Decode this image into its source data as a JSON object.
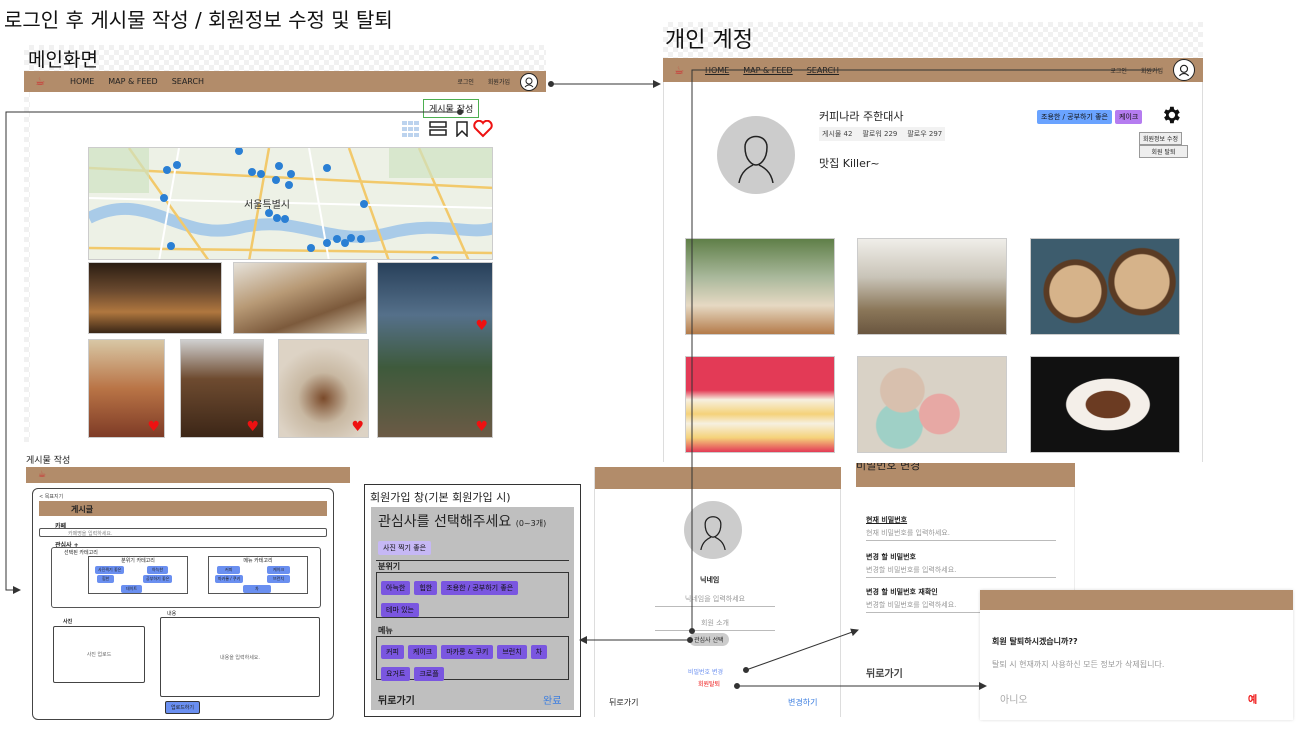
{
  "page_title": "로그인 후 게시물 작성 / 회원정보 수정 및 탈퇴",
  "main": {
    "section_title": "메인화면",
    "nav": {
      "home": "HOME",
      "map_feed": "MAP & FEED",
      "search": "SEARCH",
      "login": "로그인",
      "signup": "회원가입"
    },
    "write_button": "게시물 작성",
    "map_city_label": "서울특별시"
  },
  "account": {
    "section_title": "개인 계정",
    "nav": {
      "home": "HOME",
      "map_feed": "MAP & FEED",
      "search": "SEARCH",
      "login": "로그인",
      "signup": "회원가입"
    },
    "username": "커피나라 주한대사",
    "stats": {
      "posts": "게시물 42",
      "followers": "팔로워 229",
      "following": "팔로우 297"
    },
    "bio": "맛집 Killer~",
    "tags": [
      "조용한 / 공부하기 좋은",
      "케이크"
    ],
    "menu": {
      "edit": "회원정보 수정",
      "withdraw": "회원 탈퇴"
    }
  },
  "post_write": {
    "section_title": "게시물 작성",
    "back": "< 목표지기",
    "header": "게시글",
    "cafe_label": "카페",
    "cafe_placeholder": "카페명을 입력하세요.",
    "interest_label": "관심사",
    "selected_category": "선택된 카테고리",
    "mood_category": "분위기 카테고리",
    "menu_category": "메뉴 카테고리",
    "mood_chips": [
      "사진찍기 좋은",
      "아늑한",
      "힙한",
      "공부하기 좋은",
      "데이트"
    ],
    "menu_chips": [
      "커피",
      "케이크",
      "마카롱 / 쿠키",
      "브런치",
      "차"
    ],
    "content_label": "내용",
    "photo_label": "사진",
    "photo_upload": "사진 업로드",
    "content_placeholder": "내용을 입력하세요.",
    "upload_button": "업로드하기"
  },
  "signup_interest": {
    "section_title": "회원가입 창(기본 회원가입 시)",
    "heading": "관심사를 선택해주세요",
    "heading_note": "(0~3개)",
    "top_chip": "사진 찍기 좋은",
    "mood_label": "분위기",
    "mood_chips": [
      "아늑한",
      "힙한",
      "조용한 / 공부하기 좋은",
      "테마 있는"
    ],
    "menu_label": "메뉴",
    "menu_chips": [
      "커피",
      "케이크",
      "마카롱 & 쿠키",
      "브런치",
      "차",
      "요거트",
      "크로플"
    ],
    "back": "뒤로가기",
    "done": "완료"
  },
  "profile_edit": {
    "nickname_label": "닉네임",
    "nickname_placeholder": "닉네임을 입력하세요",
    "intro_placeholder": "회원 소개",
    "interest_button": "관심사 선택",
    "pw_change_link": "비밀번호 변경",
    "withdraw_link": "회원탈퇴",
    "back": "뒤로가기",
    "submit": "변경하기"
  },
  "password_change": {
    "section_title": "비밀번호 변경",
    "current_label": "현재 비밀번호",
    "current_placeholder": "현재 비밀번호를 입력하세요.",
    "new_label": "변경 할 비밀번호",
    "new_placeholder": "변경할 비밀번호를 입력하세요.",
    "confirm_label": "변경 할 비밀번호 재확인",
    "confirm_placeholder": "변경할 비밀번호를 입력하세요.",
    "back": "뒤로가기"
  },
  "withdraw_dialog": {
    "question": "회원 탈퇴하시겠습니까??",
    "warning": "탈퇴 시 현재까지 사용하신 모든 정보가 삭제됩니다.",
    "no": "아니오",
    "yes": "예"
  },
  "colors": {
    "brown": "#b28c6a",
    "purple": "#7a56e0",
    "blue": "#6aa3ff",
    "red": "#e11111"
  }
}
